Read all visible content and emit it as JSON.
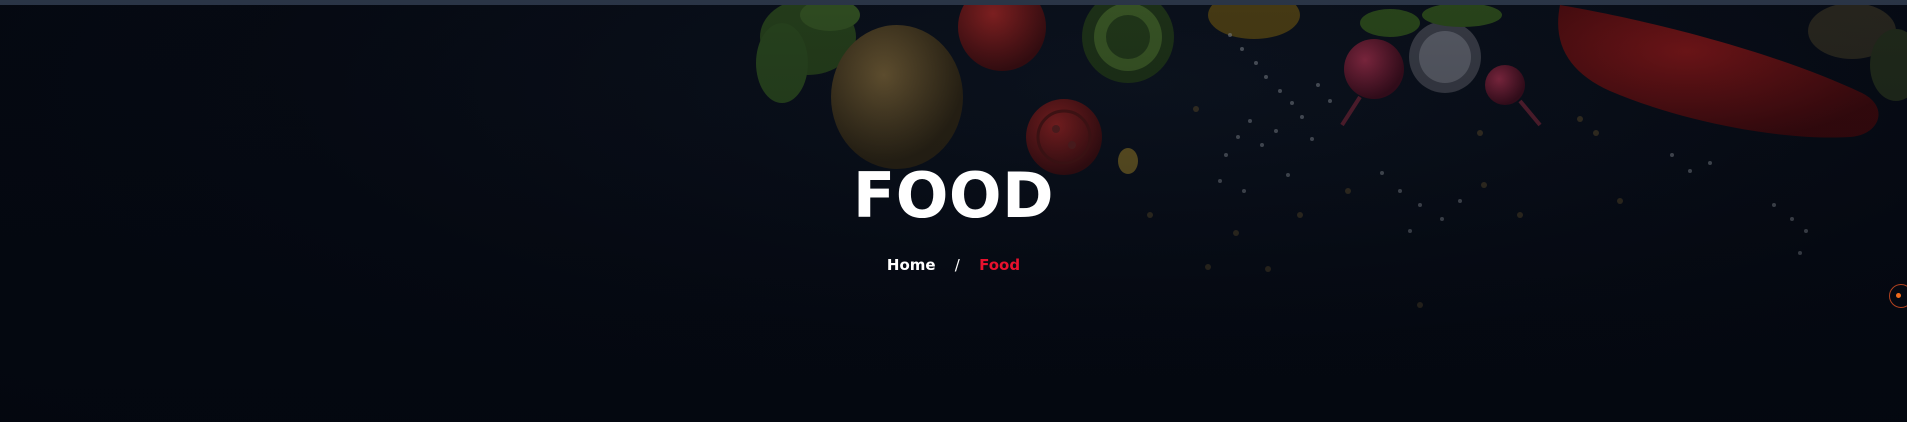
{
  "hero": {
    "title": "FOOD"
  },
  "breadcrumb": {
    "items": [
      {
        "label": "Home"
      },
      {
        "label": "Food"
      }
    ],
    "separator": "/"
  },
  "colors": {
    "background": "#050913",
    "title": "#ffffff",
    "breadcrumb_active": "#e8112d",
    "side_control": "#f06a1a"
  },
  "icons": {
    "side_control": "circle-dot-icon"
  }
}
